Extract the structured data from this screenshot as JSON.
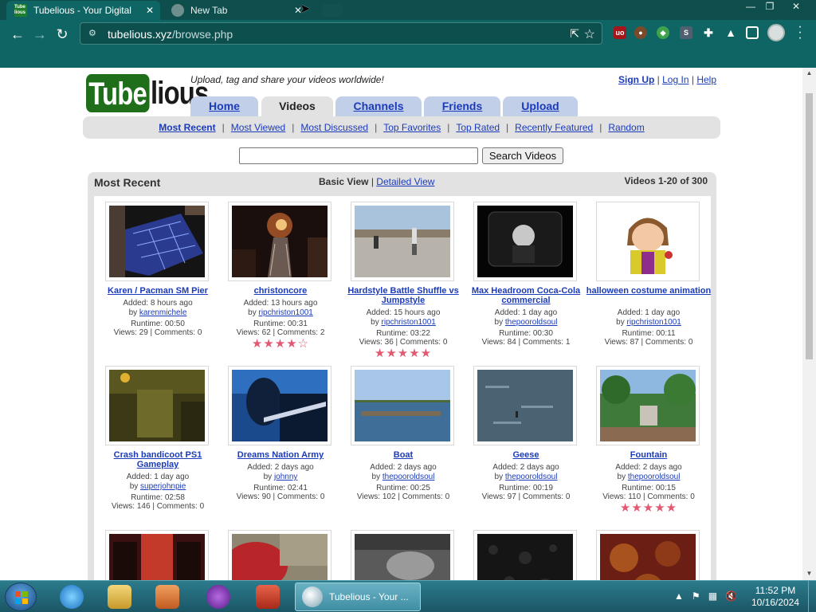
{
  "browser": {
    "tabs": [
      {
        "title": "Tubelious - Your Digital",
        "favicon": "Tube lious",
        "active": true
      },
      {
        "title": "New Tab",
        "favicon": "",
        "active": false
      }
    ],
    "url_domain": "tubelious.xyz",
    "url_path": "/browse.php"
  },
  "site": {
    "logo_part1": "Tube",
    "logo_part2": "lious",
    "tagline": "Upload, tag and share your videos worldwide!",
    "top_links": [
      "Sign Up",
      "Log In",
      "Help"
    ],
    "top_links_sep": "|",
    "nav_tabs": [
      "Home",
      "Videos",
      "Channels",
      "Friends",
      "Upload"
    ],
    "subnav": [
      "Most Recent",
      "Most Viewed",
      "Most Discussed",
      "Top Favorites",
      "Top Rated",
      "Recently Featured",
      "Random"
    ],
    "search_button": "Search Videos",
    "search_value": ""
  },
  "panel": {
    "title": "Most Recent",
    "view_current": "Basic View",
    "view_sep": " | ",
    "view_alt": "Detailed View",
    "count": "Videos 1-20 of 300"
  },
  "videos": [
    {
      "title": "Karen / Pacman SM Pier",
      "added": "Added: 8 hours ago",
      "by_label": "by",
      "user": "karenmichele",
      "runtime": "Runtime: 00:50",
      "stats": "Views: 29 | Comments: 0",
      "rating": 0
    },
    {
      "title": "christoncore",
      "added": "Added: 13 hours ago",
      "by_label": "by",
      "user": "ripchriston1001",
      "runtime": "Runtime: 00:31",
      "stats": "Views: 62 | Comments: 2",
      "rating": 4
    },
    {
      "title": "Hardstyle Battle Shuffle vs Jumpstyle",
      "added": "Added: 15 hours ago",
      "by_label": "by",
      "user": "ripchriston1001",
      "runtime": "Runtime: 03:22",
      "stats": "Views: 36 | Comments: 0",
      "rating": 5
    },
    {
      "title": "Max Headroom Coca-Cola commercial",
      "added": "Added: 1 day ago",
      "by_label": "by",
      "user": "thepooroldsoul",
      "runtime": "Runtime: 00:30",
      "stats": "Views: 84 | Comments: 1",
      "rating": 0
    },
    {
      "title": "halloween costume animation",
      "added": "Added: 1 day ago",
      "by_label": "by",
      "user": "ripchriston1001",
      "runtime": "Runtime: 00:11",
      "stats": "Views: 87 | Comments: 0",
      "rating": 0
    },
    {
      "title": "Crash bandicoot PS1 Gameplay",
      "added": "Added: 1 day ago",
      "by_label": "by",
      "user": "superjohnpie",
      "runtime": "Runtime: 02:58",
      "stats": "Views: 146 | Comments: 0",
      "rating": 0
    },
    {
      "title": "Dreams Nation Army",
      "added": "Added: 2 days ago",
      "by_label": "by",
      "user": "johnny",
      "runtime": "Runtime: 02:41",
      "stats": "Views: 90 | Comments: 0",
      "rating": 0
    },
    {
      "title": "Boat",
      "added": "Added: 2 days ago",
      "by_label": "by",
      "user": "thepooroldsoul",
      "runtime": "Runtime: 00:25",
      "stats": "Views: 102 | Comments: 0",
      "rating": 0
    },
    {
      "title": "Geese",
      "added": "Added: 2 days ago",
      "by_label": "by",
      "user": "thepooroldsoul",
      "runtime": "Runtime: 00:19",
      "stats": "Views: 97 | Comments: 0",
      "rating": 0
    },
    {
      "title": "Fountain",
      "added": "Added: 2 days ago",
      "by_label": "by",
      "user": "thepooroldsoul",
      "runtime": "Runtime: 00:15",
      "stats": "Views: 110 | Comments: 0",
      "rating": 5
    }
  ],
  "colors": {
    "link": "#1b3bb8",
    "star": "#e05a72",
    "chrome": "#0f6563",
    "logo_green": "#1e6e1a"
  },
  "taskbar": {
    "active_window": "Tubelious - Your ...",
    "time": "11:52 PM",
    "date": "10/16/2024"
  }
}
